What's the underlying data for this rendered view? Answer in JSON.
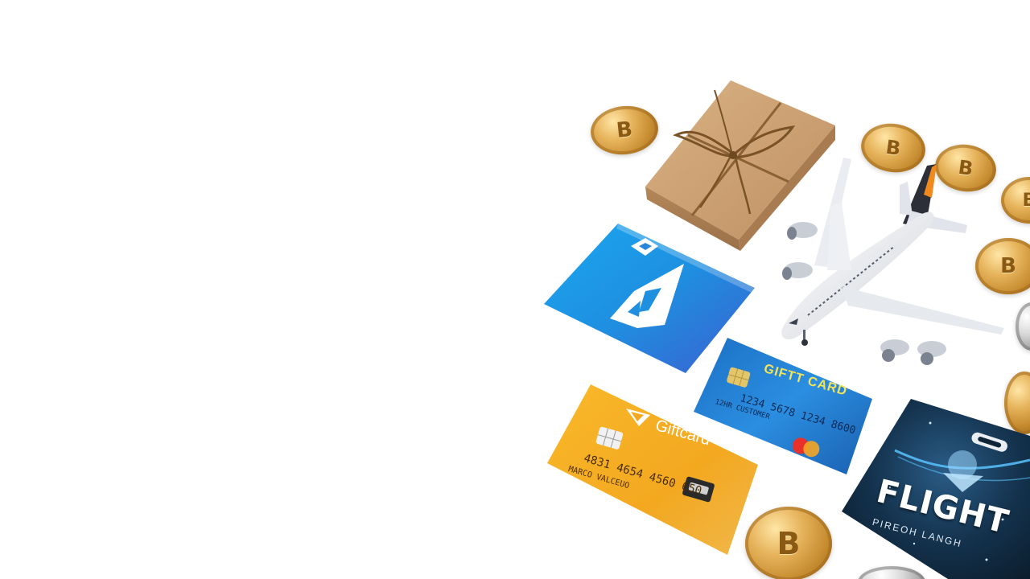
{
  "scene": {
    "background": "#ffffff",
    "palette": {
      "kraft": "#c89a6a",
      "twine": "#8a6236",
      "gold": "#e0ad55",
      "app_blue": "#1f8fe0",
      "card_blue": "#1e7fd0",
      "card_orange": "#f3a820",
      "flight_navy": "#0f2537"
    }
  },
  "items": {
    "gift_box": {
      "icon": "gift-box-icon"
    },
    "airplane": {
      "icon": "airplane-icon"
    },
    "app_card": {
      "icon": "rocket-icon"
    },
    "blue_card": {
      "title": "GIFTT CARD",
      "number": "1234 5678 1234 8600",
      "holder": "12HR CUSTOMER",
      "network_icon": "mastercard-icon"
    },
    "orange_card": {
      "title": "Giftcard",
      "number": "4831 4654 4560 650",
      "holder": "MARCO VALCEUO"
    },
    "flight_card": {
      "title": "FLIGHT",
      "subtitle": "PIREOH LANGH"
    }
  },
  "coins": [
    {
      "id": "coin-1",
      "symbol": "B"
    },
    {
      "id": "coin-2",
      "symbol": "B"
    },
    {
      "id": "coin-3",
      "symbol": "B"
    },
    {
      "id": "coin-4",
      "symbol": "B"
    },
    {
      "id": "coin-5",
      "symbol": "B"
    },
    {
      "id": "coin-6",
      "symbol": ""
    },
    {
      "id": "coin-7",
      "symbol": ""
    },
    {
      "id": "coin-8",
      "symbol": "B"
    },
    {
      "id": "coin-9",
      "symbol": ""
    }
  ]
}
